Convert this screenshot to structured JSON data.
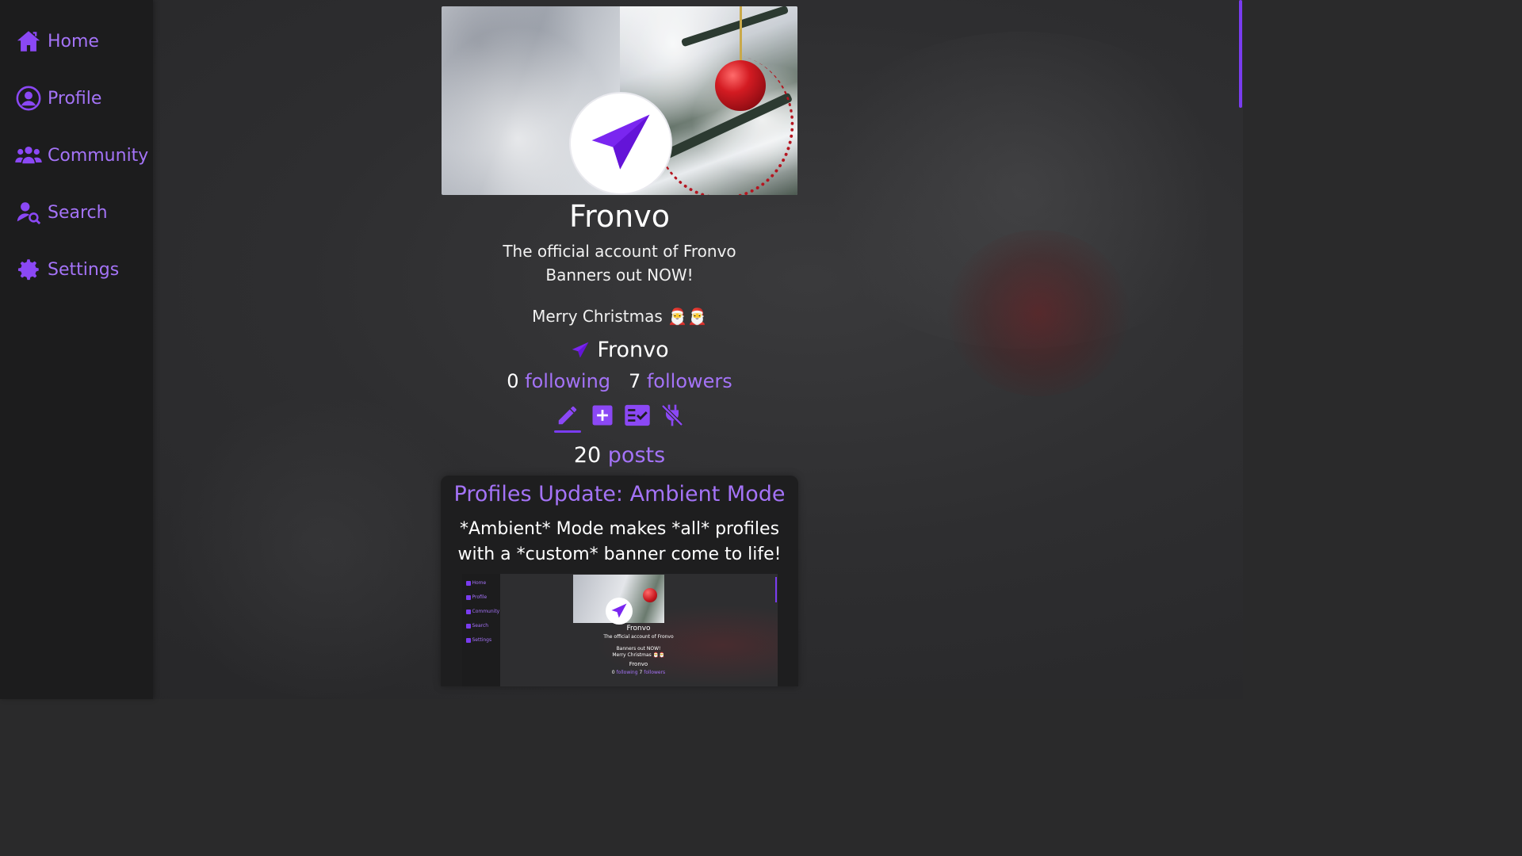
{
  "sidebar": {
    "items": [
      {
        "label": "Home",
        "icon": "home-icon"
      },
      {
        "label": "Profile",
        "icon": "profile-icon"
      },
      {
        "label": "Community",
        "icon": "community-icon"
      },
      {
        "label": "Search",
        "icon": "search-user-icon"
      },
      {
        "label": "Settings",
        "icon": "gear-icon"
      }
    ]
  },
  "profile": {
    "display_name": "Fronvo",
    "bio_line1": "The official account of Fronvo",
    "bio_line2": "Banners out NOW!",
    "bio_line3": "Merry Christmas 🎅🎅",
    "username": "Fronvo",
    "following_count": "0",
    "following_label": "following",
    "followers_count": "7",
    "followers_label": "followers",
    "posts_count": "20",
    "posts_label": "posts"
  },
  "actions": [
    {
      "icon": "edit-icon",
      "active": true
    },
    {
      "icon": "add-post-icon",
      "active": false
    },
    {
      "icon": "checklist-icon",
      "active": false
    },
    {
      "icon": "disconnect-plug-icon",
      "active": false
    }
  ],
  "post": {
    "title": "Profiles Update: Ambient Mode",
    "body": "*Ambient* Mode makes *all* profiles with a *custom* banner come to life!",
    "preview": {
      "nav": [
        "Home",
        "Profile",
        "Community",
        "Search",
        "Settings"
      ],
      "name": "Fronvo",
      "bio1": "The official account of Fronvo",
      "bio2": "Banners out NOW!",
      "bio3": "Merry Christmas 🎅🎅",
      "username": "Fronvo",
      "following_count": "0",
      "following_label": "following",
      "followers_count": "7",
      "followers_label": "followers"
    }
  },
  "colors": {
    "accent": "#a473f7",
    "accent_dark": "#7a3cf0",
    "sidebar_bg": "#1c1c1d",
    "page_bg": "#2a2a2b"
  }
}
